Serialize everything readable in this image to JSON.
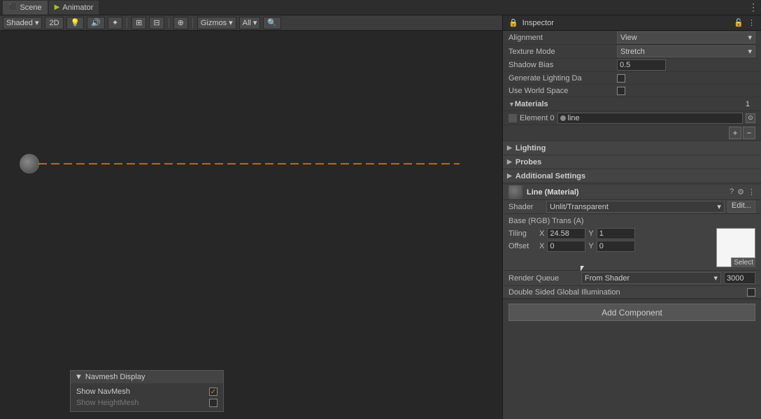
{
  "tabs": [
    {
      "label": "Scene",
      "icon": "⬛",
      "iconColor": "#c8a020"
    },
    {
      "label": "Animator",
      "icon": "▶",
      "iconColor": "#a0c820"
    }
  ],
  "sceneToolbar": {
    "shading": "Shaded",
    "mode2d": "2D",
    "gizmos": "Gizmos",
    "all": "All"
  },
  "navmesh": {
    "title": "Navmesh Display",
    "showNavMesh": "Show NavMesh",
    "showHeightMesh": "Show HeightMesh"
  },
  "inspector": {
    "title": "Inspector",
    "alignment_label": "Alignment",
    "alignment_value": "View",
    "textureMode_label": "Texture Mode",
    "textureMode_value": "Stretch",
    "shadowBias_label": "Shadow Bias",
    "shadowBias_value": "0.5",
    "genLighting_label": "Generate Lighting Da",
    "useWorldSpace_label": "Use World Space",
    "materials_label": "Materials",
    "materials_count": "1",
    "element0_label": "Element 0",
    "element0_value": "line",
    "lighting_label": "Lighting",
    "probes_label": "Probes",
    "additionalSettings_label": "Additional Settings",
    "materialPanel": {
      "name": "Line (Material)",
      "shader_label": "Shader",
      "shader_value": "Unlit/Transparent",
      "shader_edit": "Edit...",
      "textureSection_label": "Base (RGB) Trans (A)",
      "tiling_label": "Tiling",
      "tiling_x": "24.58",
      "tiling_y": "1",
      "offset_label": "Offset",
      "offset_x": "0",
      "offset_y": "0",
      "select_label": "Select",
      "renderQueue_label": "Render Queue",
      "renderQueue_value": "From Shader",
      "renderQueue_num": "3000",
      "doubleSided_label": "Double Sided Global Illumination"
    },
    "addComponent_label": "Add Component"
  }
}
